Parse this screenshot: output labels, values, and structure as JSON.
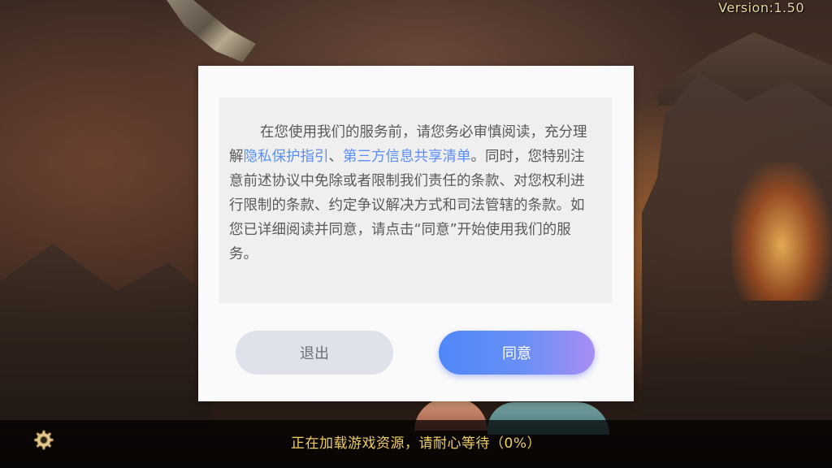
{
  "version": "Version:1.50",
  "dialog": {
    "body_part1": "在您使用我们的服务前，请您务必审慎阅读，充分理解",
    "link_privacy": "隐私保护指引",
    "separator": "、",
    "link_third_party": "第三方信息共享清单",
    "body_part2": "。同时，您特别注意前述协议中免除或者限制我们责任的条款、对您权利进行限制的条款、约定争议解决方式和司法管辖的条款。如您已详细阅读并同意，请点击“同意”开始使用我们的服务。",
    "exit_label": "退出",
    "agree_label": "同意"
  },
  "loading": {
    "text": "正在加载游戏资源，请耐心等待（0%）",
    "progress_percent": 0
  },
  "icons": {
    "settings": "gear-icon"
  },
  "colors": {
    "link": "#5b8ff5",
    "loading_text": "#f0cf63",
    "version_text": "#e8d9a0",
    "agree_gradient_start": "#4f87f7",
    "agree_gradient_end": "#a98ef4",
    "exit_button": "#dfe2eb"
  }
}
